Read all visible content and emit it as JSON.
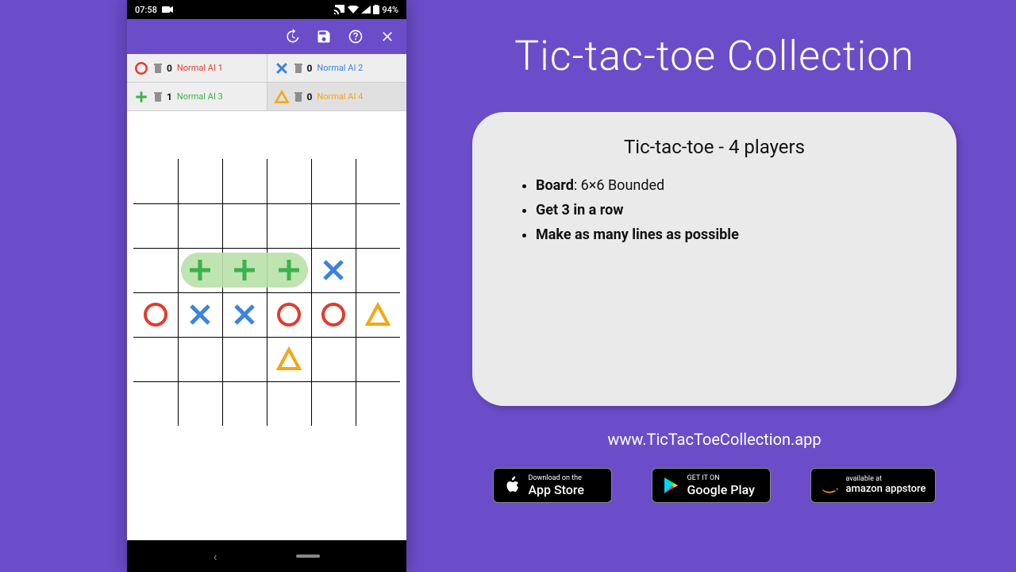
{
  "status": {
    "time": "07:58",
    "battery_pct": "94%"
  },
  "players": [
    {
      "score": "0",
      "name": "Normal AI 1",
      "color": "#e23b2e",
      "mark": "circle"
    },
    {
      "score": "0",
      "name": "Normal AI 2",
      "color": "#3b82e2",
      "mark": "cross"
    },
    {
      "score": "1",
      "name": "Normal AI 3",
      "color": "#3bb24a",
      "mark": "plus"
    },
    {
      "score": "0",
      "name": "Normal AI 4",
      "color": "#f4a614",
      "mark": "triangle"
    }
  ],
  "board": {
    "size": 6,
    "highlight": {
      "row": 2,
      "col_start": 1,
      "col_end": 3
    },
    "cells": [
      {
        "r": 2,
        "c": 1,
        "mark": "plus",
        "color": "#3bb24a"
      },
      {
        "r": 2,
        "c": 2,
        "mark": "plus",
        "color": "#3bb24a"
      },
      {
        "r": 2,
        "c": 3,
        "mark": "plus",
        "color": "#3bb24a"
      },
      {
        "r": 2,
        "c": 4,
        "mark": "cross",
        "color": "#3b82e2"
      },
      {
        "r": 3,
        "c": 0,
        "mark": "circle",
        "color": "#e23b2e"
      },
      {
        "r": 3,
        "c": 1,
        "mark": "cross",
        "color": "#3b82e2"
      },
      {
        "r": 3,
        "c": 2,
        "mark": "cross",
        "color": "#3b82e2"
      },
      {
        "r": 3,
        "c": 3,
        "mark": "circle",
        "color": "#e23b2e"
      },
      {
        "r": 3,
        "c": 4,
        "mark": "circle",
        "color": "#e23b2e"
      },
      {
        "r": 3,
        "c": 5,
        "mark": "triangle",
        "color": "#f4a614"
      },
      {
        "r": 4,
        "c": 3,
        "mark": "triangle",
        "color": "#f4a614"
      }
    ]
  },
  "promo": {
    "title": "Tic-tac-toe Collection",
    "card_title": "Tic-tac-toe - 4 players",
    "bullet1_label": "Board",
    "bullet1_value": ":  6×6 Bounded",
    "bullet2": "Get 3 in a row",
    "bullet3": "Make as many lines as possible",
    "url": "www.TicTacToeCollection.app"
  },
  "stores": {
    "apple_small": "Download on the",
    "apple_big": "App Store",
    "google_small": "GET IT ON",
    "google_big": "Google Play",
    "amazon_small": "available at",
    "amazon_big": "amazon appstore"
  }
}
